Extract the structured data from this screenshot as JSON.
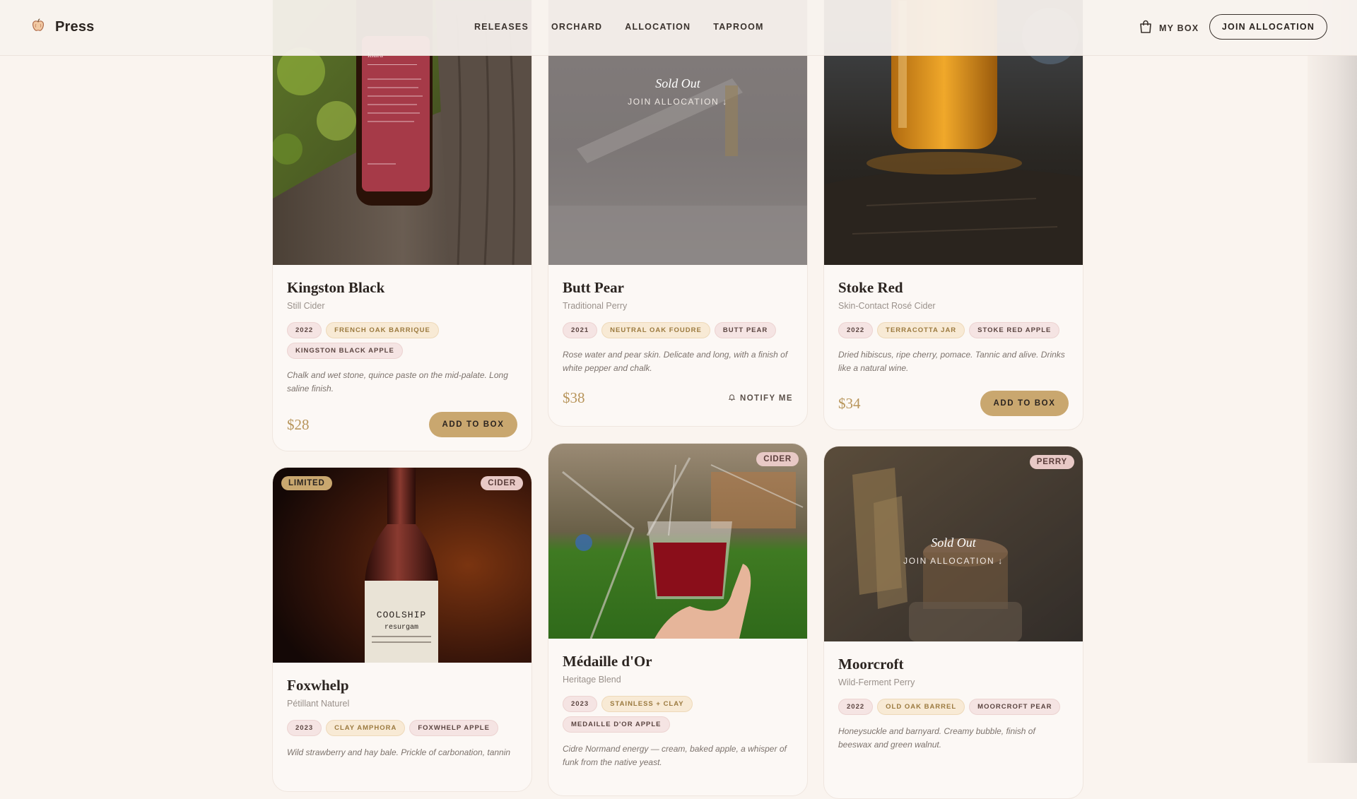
{
  "nav": {
    "brand": "Press",
    "links": [
      "RELEASES",
      "ORCHARD",
      "ALLOCATION",
      "TAPROOM"
    ],
    "my_box": "MY BOX",
    "join": "JOIN ALLOCATION"
  },
  "colors": {
    "background": "#faf4ef",
    "accent_gold": "#c9a76f",
    "price_gold": "#b8955b",
    "tag_rose": "#f5e4e3",
    "tag_sand": "#f8ead5"
  },
  "cards": [
    {
      "name": "Kingston Black",
      "style": "Still Cider",
      "tags": [
        "2022",
        "FRENCH OAK BARRIQUE",
        "KINGSTON BLACK APPLE"
      ],
      "notes": "Chalk and wet stone, quince paste on the mid-palate. Long saline finish.",
      "price": "$28",
      "action": "ADD TO BOX"
    },
    {
      "name": "Butt Pear",
      "style": "Traditional Perry",
      "tags": [
        "2021",
        "NEUTRAL OAK FOUDRE",
        "BUTT PEAR"
      ],
      "notes": "Rose water and pear skin. Delicate and long, with a finish of white pepper and chalk.",
      "price": "$38",
      "action": "NOTIFY ME",
      "sold_out": "Sold Out",
      "sold_out_link": "JOIN ALLOCATION ↓"
    },
    {
      "name": "Stoke Red",
      "style": "Skin-Contact Rosé Cider",
      "tags": [
        "2022",
        "TERRACOTTA JAR",
        "STOKE RED APPLE"
      ],
      "notes": "Dried hibiscus, ripe cherry, pomace. Tannic and alive. Drinks like a natural wine.",
      "price": "$34",
      "action": "ADD TO BOX"
    },
    {
      "name": "Foxwhelp",
      "style": "Pétillant Naturel",
      "tags": [
        "2023",
        "CLAY AMPHORA",
        "FOXWHELP APPLE"
      ],
      "notes": "Wild strawberry and hay bale. Prickle of carbonation, tannin",
      "badge_limited": "LIMITED",
      "badge_type": "CIDER"
    },
    {
      "name": "Médaille d'Or",
      "style": "Heritage Blend",
      "tags": [
        "2023",
        "STAINLESS + CLAY",
        "MEDAILLE D'OR APPLE"
      ],
      "notes": "Cidre Normand energy — cream, baked apple, a whisper of funk from the native yeast.",
      "badge_type": "CIDER"
    },
    {
      "name": "Moorcroft",
      "style": "Wild-Ferment Perry",
      "tags": [
        "2022",
        "OLD OAK BARREL",
        "MOORCROFT PEAR"
      ],
      "notes": "Honeysuckle and barnyard. Creamy bubble, finish of beeswax and green walnut.",
      "badge_type": "PERRY",
      "sold_out": "Sold Out",
      "sold_out_link": "JOIN ALLOCATION ↓"
    }
  ]
}
